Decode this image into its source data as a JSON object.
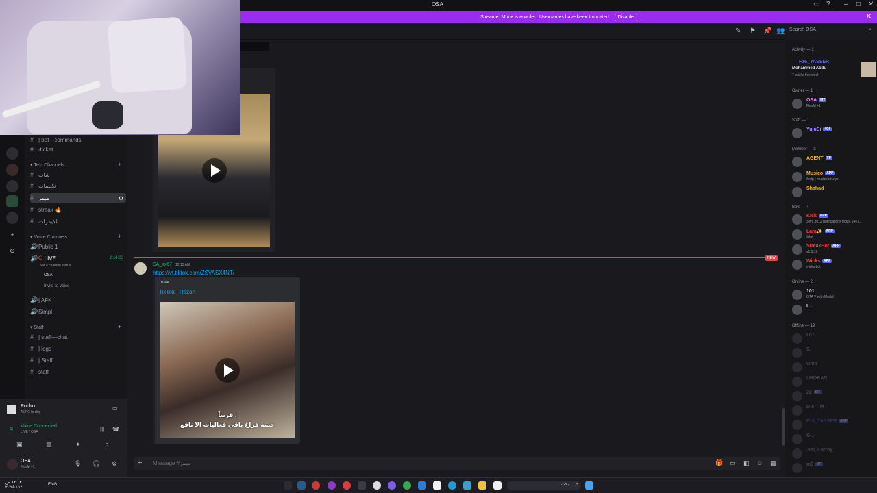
{
  "window": {
    "title": "OSA"
  },
  "banner": {
    "text": "Streamer Mode is enabled. Usernames have been truncated.",
    "disable_label": "Disable"
  },
  "header": {
    "search_placeholder": "Search OSA"
  },
  "channels": {
    "top_items": [
      "| bot—commands",
      "-ticket"
    ],
    "text_category": "Text Channels",
    "text_items": [
      "شات",
      "تكليمات",
      "ميمز",
      "streak 🔥",
      "الايمرات"
    ],
    "voice_category": "Voice Channels",
    "voice_items": [
      "Public 1",
      "LIVE",
      "| AFK",
      "Simpl"
    ],
    "live_timer": "2:14:03",
    "live_status_hint": "Set a channel status",
    "live_user": "OSA",
    "invite_label": "Invite to Voice",
    "staff_category": "Staff",
    "staff_items": [
      "| staff—chat",
      "| logs",
      "| Staff",
      "staff"
    ]
  },
  "activity_panel": {
    "title": "Roblox",
    "hint": "ALT C to clip"
  },
  "voice_status": {
    "title": "Voice Connected",
    "sub": "LIVE / OSA"
  },
  "user": {
    "name": "OSA",
    "status": "FlexM +1"
  },
  "chat": {
    "new_badge": "NEW",
    "message": {
      "author": "SA_xx67",
      "time": "12:13 AM",
      "link": "https://vt.tiktok.com/ZSVASX4NT/",
      "embed_provider": "TikTok",
      "embed_title": "TikTok · Razan",
      "caption_top": "قريباً :",
      "caption_bottom": "حصة فراغ باقي فعاليات الا نافغ"
    },
    "input_placeholder": "Message #ميمز"
  },
  "members": {
    "activity_header": "Activity — 1",
    "activity": {
      "name": "F16_YASSER",
      "sub1": "Mohammed Abdu",
      "sub2": "7 tracks this week"
    },
    "owner_header": "Owner — 1",
    "owner": [
      {
        "name": "OSA",
        "tag": "MT",
        "sub": "FlexM +1",
        "color": "#f47fff"
      }
    ],
    "staff_header": "Staff — 1",
    "staff": [
      {
        "name": "YujuSi",
        "tag": "404",
        "sub": "",
        "color": "#a58bff"
      }
    ],
    "member_header": "Member — 3",
    "member": [
      {
        "name": "AGENT",
        "tag": "VF",
        "sub": "",
        "color": "#f0b232"
      },
      {
        "name": "Musico",
        "tag": "APP",
        "sub": "/help | musicobot.xyz",
        "color": "#f0b232"
      },
      {
        "name": "Shahad",
        "tag": "",
        "sub": "",
        "color": "#f0b232"
      }
    ],
    "bots_header": "Bots — 4",
    "bots": [
      {
        "name": "Kick",
        "tag": "APP",
        "sub": "Sent 3012 notifications today. (447...",
        "color": "#f23f43"
      },
      {
        "name": "Lara✨",
        "tag": "APP",
        "sub": "/play",
        "color": "#f23f43"
      },
      {
        "name": "StreakBot",
        "tag": "APP",
        "sub": "v1.3.16",
        "color": "#f23f43"
      },
      {
        "name": "Wicks",
        "tag": "APP",
        "sub": "wicks.bot",
        "color": "#f23f43"
      }
    ],
    "online_header": "Online — 2",
    "online": [
      {
        "name": "101",
        "tag": "",
        "sub": "GTA V with Medal",
        "color": "#dbdee1"
      },
      {
        "name": "L...",
        "tag": "",
        "sub": "",
        "color": "#dbdee1"
      }
    ],
    "offline_header": "Offline — 19",
    "offline": [
      {
        "name": "I 07",
        "tag": "",
        "color": "#949ba4"
      },
      {
        "name": "S.",
        "tag": "",
        "color": "#949ba4"
      },
      {
        "name": "Omd",
        "tag": "",
        "color": "#949ba4"
      },
      {
        "name": "l MORAD",
        "tag": "",
        "color": "#949ba4"
      },
      {
        "name": "22",
        "tag": "MT",
        "color": "#949ba4"
      },
      {
        "name": "D A T M",
        "tag": "",
        "color": "#949ba4"
      },
      {
        "name": "F16_YASSER",
        "tag": "ARF",
        "color": "#5865f2"
      },
      {
        "name": "G...",
        "tag": "",
        "color": "#949ba4"
      },
      {
        "name": "Jim_Carrey",
        "tag": "",
        "color": "#949ba4"
      },
      {
        "name": "m3",
        "tag": "VF",
        "color": "#949ba4"
      }
    ]
  },
  "taskbar": {
    "clock": "١٢:١٣ ص",
    "date": "٢٠٢٥/٠٤/١٢",
    "lang": "ENG",
    "search_label": "بحث"
  }
}
